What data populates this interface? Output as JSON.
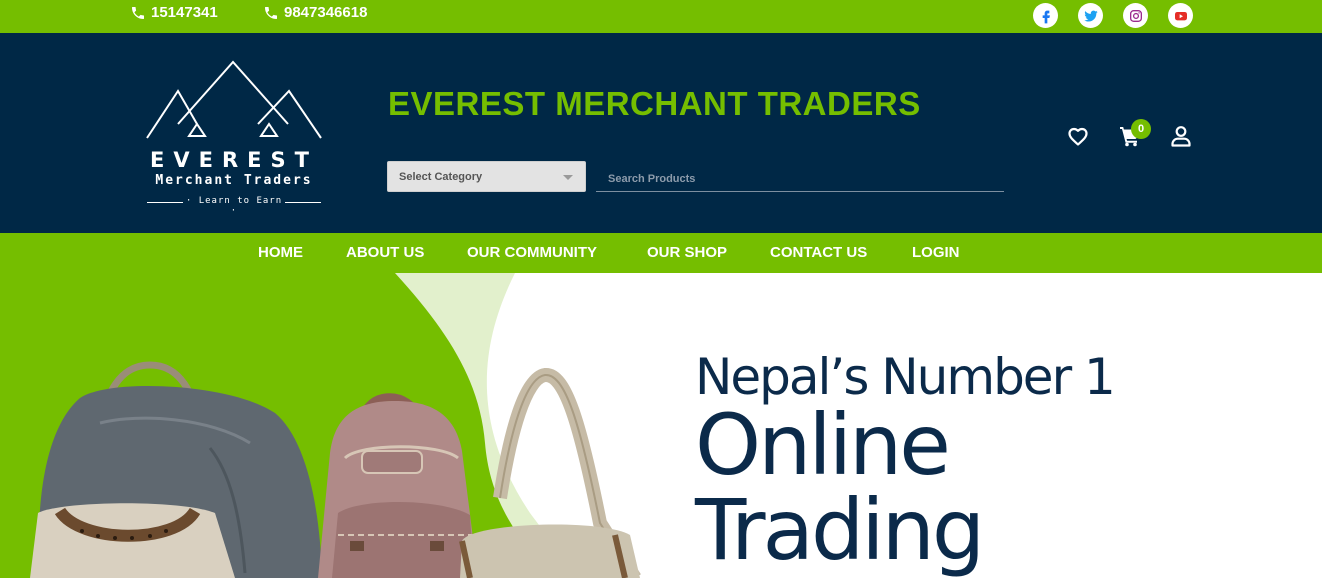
{
  "topbar": {
    "phone_1": "15147341",
    "phone_2": "9847346618",
    "socials": [
      "facebook-icon",
      "twitter-icon",
      "instagram-icon",
      "youtube-icon"
    ],
    "colors": {
      "green": "#75be00",
      "navy": "#002846"
    }
  },
  "header": {
    "logo_word": "EVEREST",
    "logo_sub": "Merchant Traders",
    "logo_tagline": "Learn to Earn",
    "title": "EVEREST MERCHANT TRADERS",
    "category_select": "Select Category",
    "search_placeholder": "Search Products",
    "cart_count": "0",
    "icons": [
      "heart-icon",
      "cart-icon",
      "user-icon"
    ]
  },
  "nav": {
    "items": [
      "HOME",
      "ABOUT US",
      "OUR COMMUNITY",
      "OUR SHOP",
      "CONTACT US",
      "LOGIN"
    ]
  },
  "hero": {
    "line_1": "Nepal’s Number 1",
    "line_2": "Online",
    "line_3": "Trading"
  }
}
